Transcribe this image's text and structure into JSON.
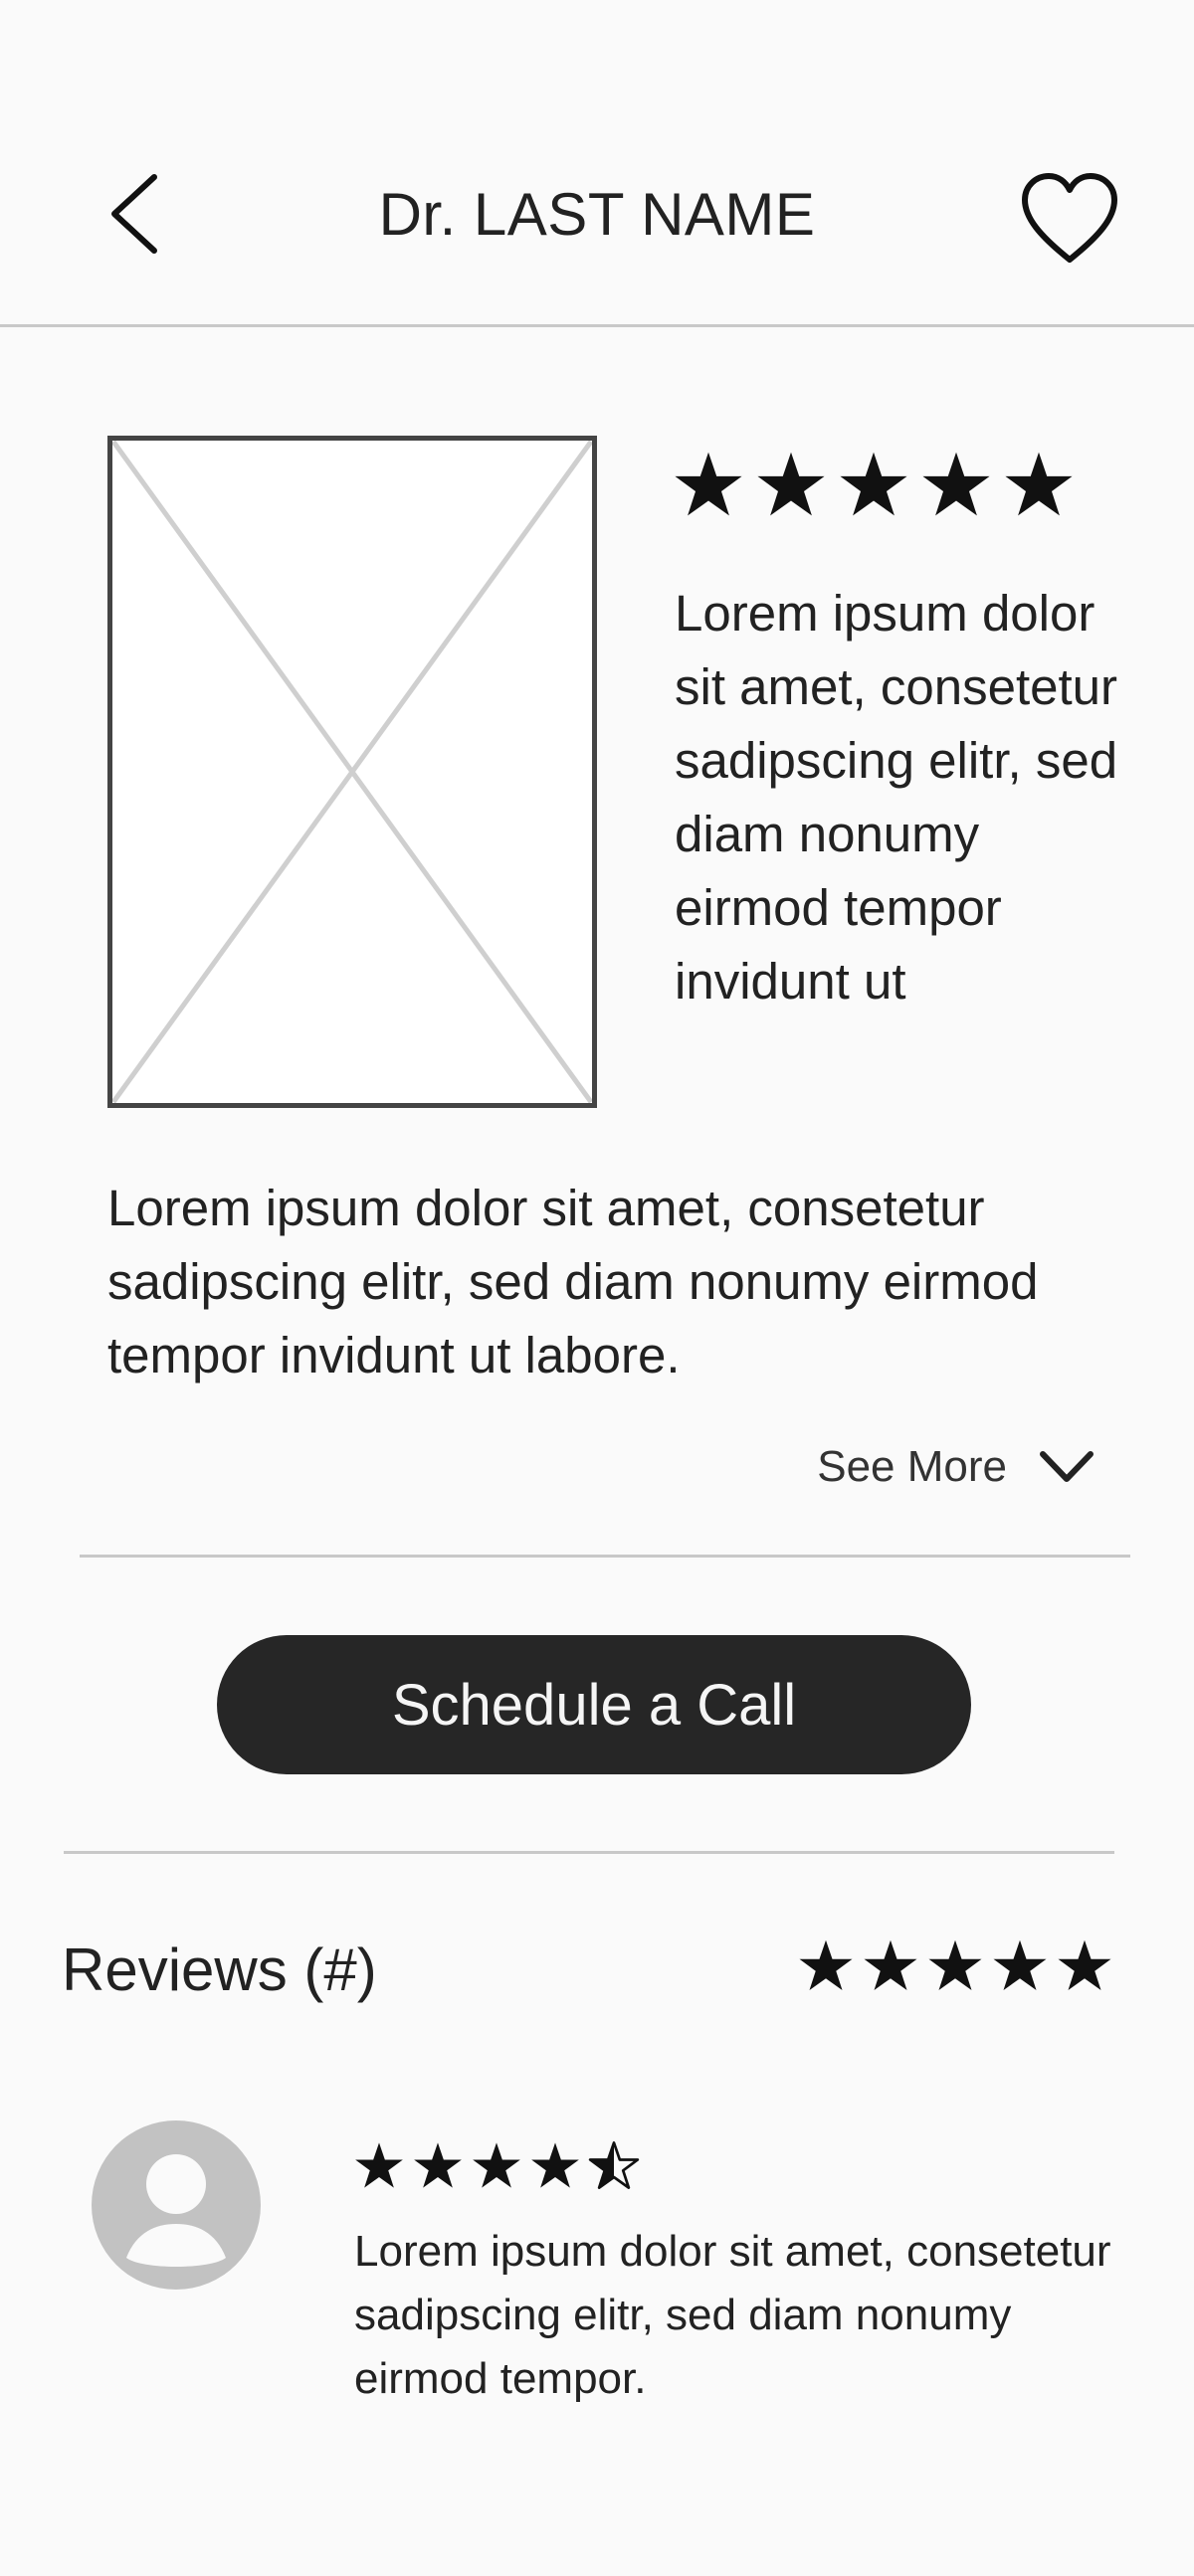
{
  "header": {
    "title": "Dr. LAST NAME",
    "back_icon": "chevron-left-icon",
    "favorite_icon": "heart-outline-icon"
  },
  "profile": {
    "photo_icon": "image-placeholder",
    "rating": 5,
    "rating_max": 5,
    "short_bio": "Lorem ipsum dolor sit amet, consetetur sadipscing elitr, sed diam nonumy eirmod tempor invidunt ut",
    "long_bio": "Lorem ipsum dolor sit amet, consetetur sadipscing elitr, sed diam nonumy eirmod tempor invidunt ut labore.",
    "see_more_label": "See More",
    "see_more_icon": "chevron-down-icon"
  },
  "cta": {
    "label": "Schedule a Call"
  },
  "reviews": {
    "title": "Reviews (#)",
    "overall_rating": 5,
    "rating_max": 5,
    "items": [
      {
        "avatar_icon": "user-avatar-icon",
        "rating": 4.5,
        "text": "Lorem ipsum dolor sit amet, consetetur sadipscing elitr, sed diam nonumy eirmod tempor."
      }
    ]
  },
  "colors": {
    "background": "#fafafa",
    "text": "#222222",
    "divider": "#c8c8c8",
    "button": "#262626",
    "button_text": "#f5f5f5",
    "avatar": "#c2c2c2"
  }
}
